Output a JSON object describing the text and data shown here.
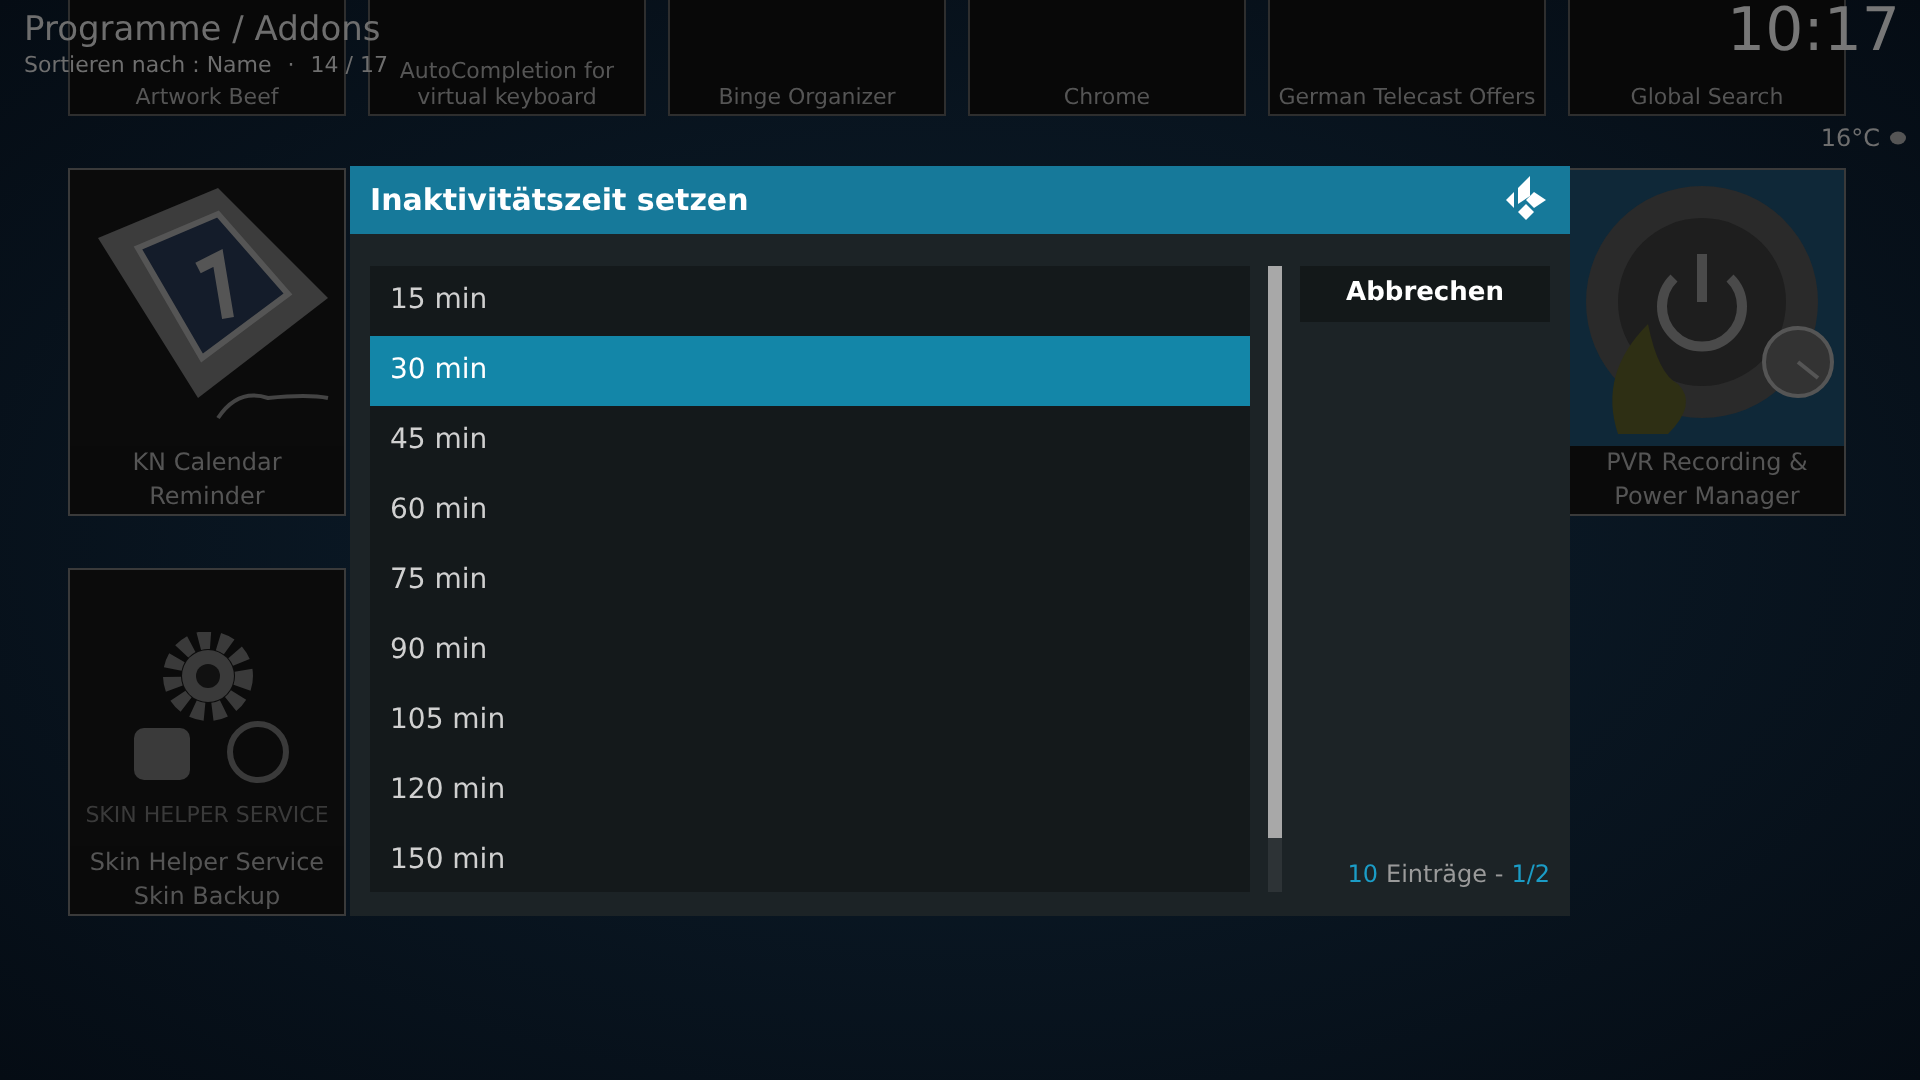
{
  "header": {
    "title": "Programme / Addons",
    "sort": "Sortieren nach : Name",
    "separator": "·",
    "count": "14 / 17"
  },
  "clock": {
    "time": "10:17",
    "temperature": "16°C"
  },
  "tile_rows": [
    [
      {
        "label": "Artwork Beef",
        "kind": "dark"
      },
      {
        "label": "AutoCompletion for virtual keyboard",
        "kind": "dark"
      },
      {
        "label": "Binge Organizer",
        "kind": "monitor"
      },
      {
        "label": "Chrome",
        "kind": "dark"
      },
      {
        "label": "German Telecast Offers",
        "kind": "dark"
      },
      {
        "label": "Global Search",
        "kind": "dark"
      }
    ],
    [
      {
        "label": "KN Calendar Reminder",
        "kind": "calendar"
      },
      {
        "kind": "hidden"
      },
      {
        "kind": "hidden"
      },
      {
        "kind": "hidden"
      },
      {
        "kind": "hidden"
      },
      {
        "label": "PVR Recording & Power Manager",
        "kind": "power"
      }
    ],
    [
      {
        "label": "Skin Helper Service Skin Backup",
        "kind": "gear",
        "logo": "SKIN HELPER SERVICE"
      }
    ]
  ],
  "dialog": {
    "title": "Inaktivitätszeit setzen",
    "items": [
      {
        "label": "15 min",
        "selected": false
      },
      {
        "label": "30 min",
        "selected": true
      },
      {
        "label": "45 min",
        "selected": false
      },
      {
        "label": "60 min",
        "selected": false
      },
      {
        "label": "75 min",
        "selected": false
      },
      {
        "label": "90 min",
        "selected": false
      },
      {
        "label": "105 min",
        "selected": false
      },
      {
        "label": "120 min",
        "selected": false
      },
      {
        "label": "150 min",
        "selected": false
      }
    ],
    "cancel_button": "Abbrechen",
    "footer": {
      "count": "10",
      "label": "Einträge -",
      "page": "1/2"
    }
  }
}
